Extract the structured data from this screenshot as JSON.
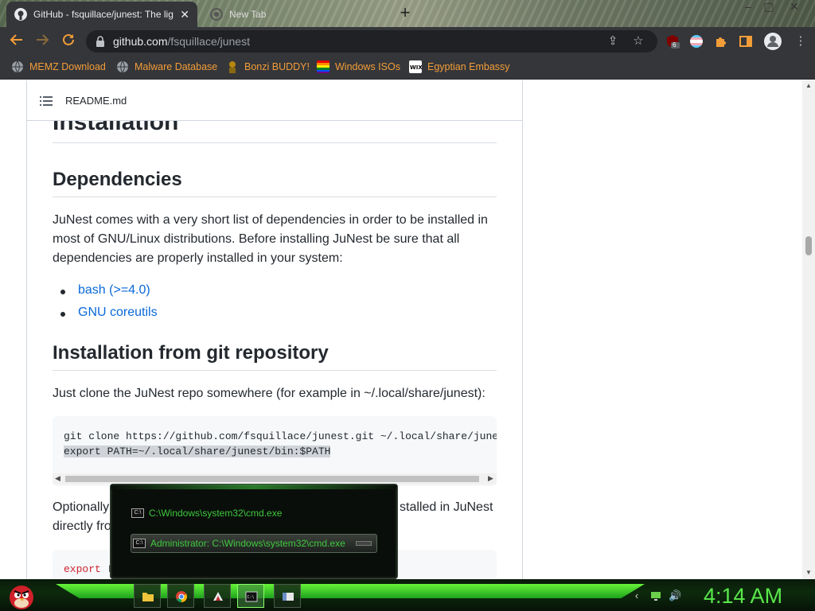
{
  "browser": {
    "tabs": [
      {
        "title": "GitHub - fsquillace/junest: The lig",
        "close": "✕"
      },
      {
        "title": "New Tab"
      }
    ],
    "new_tab": "+",
    "window_controls": {
      "min": "–",
      "max": "▢",
      "close": "✕"
    },
    "url_host": "github.com",
    "url_path": "/fsquillace/junest",
    "extension_badge": "6",
    "bookmarks": [
      {
        "label": "MEMZ Download",
        "icon": "globe-icon"
      },
      {
        "label": "Malware Database",
        "icon": "globe-icon"
      },
      {
        "label": "Bonzi BUDDY!",
        "icon": "bonzi-icon"
      },
      {
        "label": "Windows ISOs",
        "icon": "windows-flag-icon"
      },
      {
        "label": "Egyptian Embassy",
        "icon": "wix-icon"
      }
    ]
  },
  "readme": {
    "filename": "README.md",
    "h_installation": "Installation",
    "h_dependencies": "Dependencies",
    "deps_para": "JuNest comes with a very short list of dependencies in order to be installed in most of GNU/Linux distributions. Before installing JuNest be sure that all dependencies are properly installed in your system:",
    "deps": [
      "bash (>=4.0)",
      "GNU coreutils"
    ],
    "h_git": "Installation from git repository",
    "git_para": "Just clone the JuNest repo somewhere (for example in ~/.local/share/junest):",
    "code_line1": "git clone https://github.com/fsquillace/junest.git ~/.local/share/junest",
    "code_line2": "export PATH=~/.local/share/junest/bin:$PATH",
    "after_para_left": "Optionally",
    "after_para_right": "stalled in JuNest",
    "after_para_line2": "directly fro",
    "code2_left": "export",
    "code2_right": "F"
  },
  "popup": {
    "items": [
      {
        "label": "C:\\Windows\\system32\\cmd.exe"
      },
      {
        "label": "Administrator: C:\\Windows\\system32\\cmd.exe"
      }
    ]
  },
  "taskbar": {
    "clock": "4:14 AM"
  },
  "colors": {
    "link": "#0969da",
    "chrome_accent": "#f29d38",
    "clock_green": "#59e84a"
  }
}
